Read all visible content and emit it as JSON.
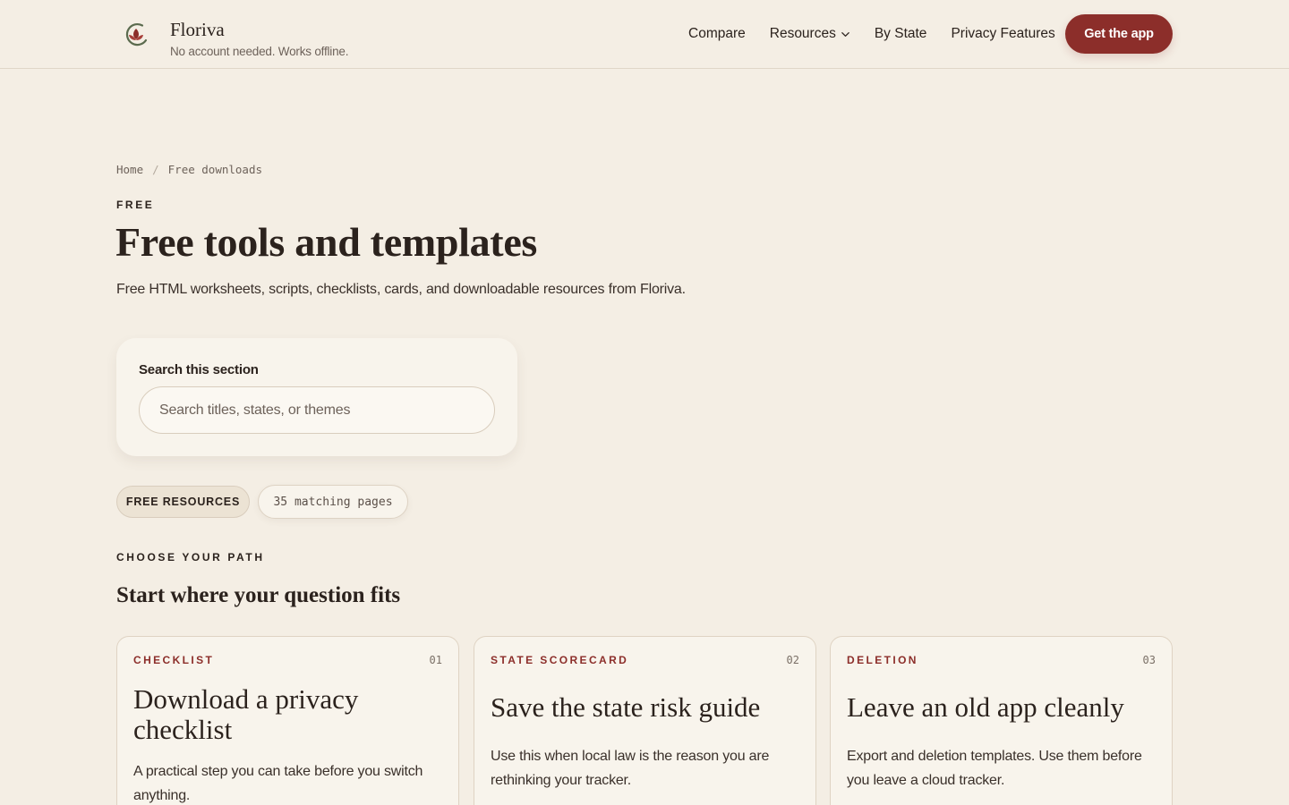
{
  "header": {
    "brand_name": "Floriva",
    "tagline": "No account needed. Works offline.",
    "nav": [
      "Compare",
      "Resources",
      "By State",
      "Privacy Features"
    ],
    "cta": "Get the app"
  },
  "breadcrumb": [
    "Home",
    "/",
    "Free downloads"
  ],
  "page": {
    "eyebrow": "FREE",
    "title": "Free tools and templates",
    "lede": "Free HTML worksheets, scripts, checklists, cards, and downloadable resources from Floriva."
  },
  "search": {
    "label": "Search this section",
    "placeholder": "Search titles, states, or themes"
  },
  "filters": {
    "active": "FREE RESOURCES",
    "count": "35 matching pages"
  },
  "paths": {
    "eyebrow": "CHOOSE YOUR PATH",
    "title": "Start where your question fits",
    "cards": [
      {
        "kicker": "CHECKLIST",
        "num": "01",
        "title": "Download a privacy checklist",
        "body": "A practical step you can take before you switch anything."
      },
      {
        "kicker": "STATE SCORECARD",
        "num": "02",
        "title": "Save the state risk guide",
        "body": "Use this when local law is the reason you are rethinking your tracker."
      },
      {
        "kicker": "DELETION",
        "num": "03",
        "title": "Leave an old app cleanly",
        "body": "Export and deletion templates. Use them before you leave a cloud tracker."
      }
    ]
  },
  "colors": {
    "background": "#f4eee4",
    "accent": "#8c2e2a",
    "card": "#f8f4ec"
  }
}
